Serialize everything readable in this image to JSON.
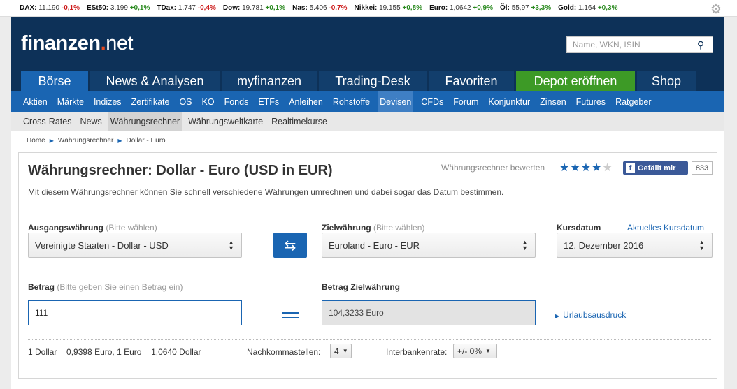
{
  "ticker": [
    {
      "name": "DAX:",
      "value": "11.190",
      "change": "-0,1%",
      "dir": "neg"
    },
    {
      "name": "ESt50:",
      "value": "3.199",
      "change": "+0,1%",
      "dir": "pos"
    },
    {
      "name": "TDax:",
      "value": "1.747",
      "change": "-0,4%",
      "dir": "neg"
    },
    {
      "name": "Dow:",
      "value": "19.781",
      "change": "+0,1%",
      "dir": "pos"
    },
    {
      "name": "Nas:",
      "value": "5.406",
      "change": "-0,7%",
      "dir": "neg"
    },
    {
      "name": "Nikkei:",
      "value": "19.155",
      "change": "+0,8%",
      "dir": "pos"
    },
    {
      "name": "Euro:",
      "value": "1,0642",
      "change": "+0,9%",
      "dir": "pos"
    },
    {
      "name": "Öl:",
      "value": "55,97",
      "change": "+3,3%",
      "dir": "pos"
    },
    {
      "name": "Gold:",
      "value": "1.164",
      "change": "+0,3%",
      "dir": "pos"
    }
  ],
  "header": {
    "logo_main": "finanzen",
    "logo_dot": ".",
    "logo_net": "net",
    "search_placeholder": "Name, WKN, ISIN"
  },
  "main_nav": [
    "Börse",
    "News & Analysen",
    "myfinanzen",
    "Trading-Desk",
    "Favoriten",
    "Depot eröffnen",
    "Shop"
  ],
  "sub_nav": [
    "Aktien",
    "Märkte",
    "Indizes",
    "Zertifikate",
    "OS",
    "KO",
    "Fonds",
    "ETFs",
    "Anleihen",
    "Rohstoffe",
    "Devisen",
    "CFDs",
    "Forum",
    "Konjunktur",
    "Zinsen",
    "Futures",
    "Ratgeber"
  ],
  "third_nav": [
    "Cross-Rates",
    "News",
    "Währungsrechner",
    "Währungsweltkarte",
    "Realtimekurse"
  ],
  "breadcrumb": [
    "Home",
    "Währungsrechner",
    "Dollar - Euro"
  ],
  "calculator": {
    "title": "Währungsrechner: Dollar - Euro (USD in EUR)",
    "description": "Mit diesem Währungsrechner können Sie schnell verschiedene Währungen umrechnen und dabei sogar das Datum bestimmen.",
    "rate_label": "Währungsrechner bewerten",
    "stars_on": "★★★★",
    "stars_off": "★",
    "fb_label": "Gefällt mir",
    "fb_count": "833",
    "source_label": "Ausgangswährung",
    "source_hint": "(Bitte wählen)",
    "source_value": "Vereinigte Staaten - Dollar - USD",
    "target_label": "Zielwährung",
    "target_hint": "(Bitte wählen)",
    "target_value": "Euroland - Euro - EUR",
    "date_label": "Kursdatum",
    "date_link": "Aktuelles Kursdatum",
    "date_value": "12. Dezember 2016",
    "amount_label": "Betrag",
    "amount_hint": "(Bitte geben Sie einen Betrag ein)",
    "amount_value": "111",
    "result_label": "Betrag Zielwährung",
    "result_value": "104,3233 Euro",
    "print_link": "Urlaubsausdruck",
    "rate_info": "1 Dollar = 0,9398 Euro, 1 Euro = 1,0640 Dollar",
    "decimals_label": "Nachkommastellen:",
    "decimals_value": "4",
    "bank_label": "Interbankenrate:",
    "bank_value": "+/- 0%"
  }
}
